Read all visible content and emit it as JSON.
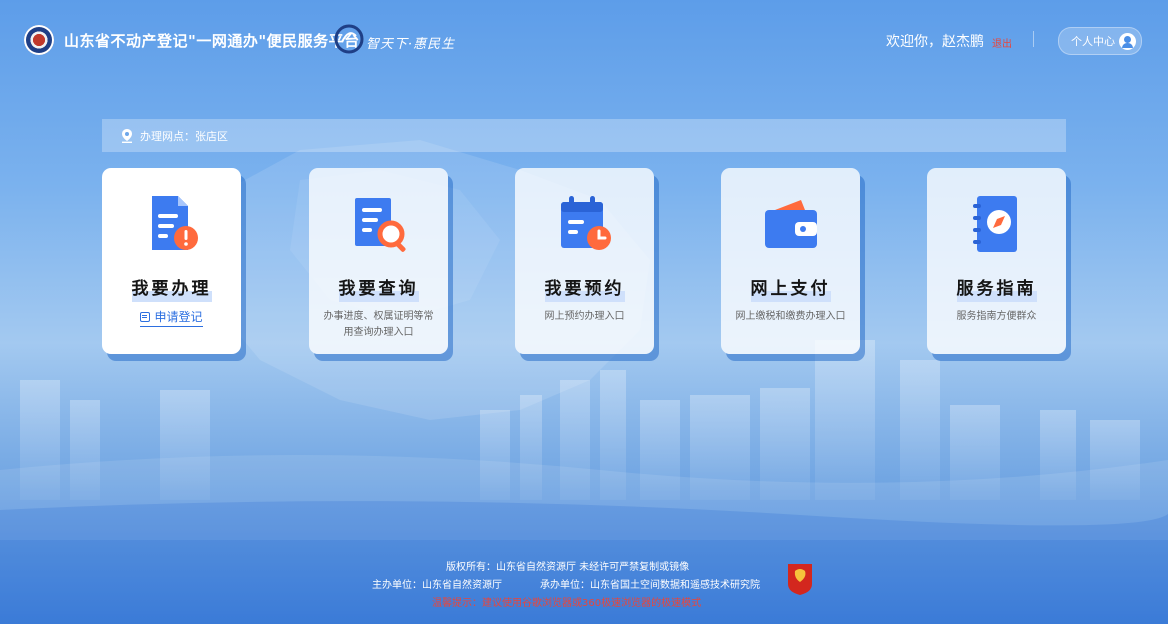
{
  "header": {
    "site_title": "山东省不动产登记\"一网通办\"便民服务平台",
    "slogan": "智天下·惠民生",
    "welcome": "欢迎你，赵杰鹏",
    "logout_label": "退出",
    "user_center_label": "个人中心"
  },
  "location": {
    "label": "办理网点：张店区"
  },
  "cards": [
    {
      "title": "我要办理",
      "link_label": "申请登记",
      "icon": "document-alert-icon"
    },
    {
      "title": "我要查询",
      "desc": "办事进度、权属证明等常用查询办理入口",
      "icon": "document-search-icon"
    },
    {
      "title": "我要预约",
      "desc": "网上预约办理入口",
      "icon": "calendar-clock-icon"
    },
    {
      "title": "网上支付",
      "desc": "网上缴税和缴费办理入口",
      "icon": "wallet-icon"
    },
    {
      "title": "服务指南",
      "desc": "服务指南方便群众",
      "icon": "compass-book-icon"
    }
  ],
  "footer": {
    "copyright": "版权所有：山东省自然资源厅 未经许可严禁复制或镜像",
    "host": "主办单位：山东省自然资源厅",
    "organizer": "承办单位：山东省国土空间数据和遥感技术研究院",
    "tip": "温馨提示：建议使用谷歌浏览器或360极速浏览器的极速模式"
  },
  "colors": {
    "accent_blue": "#2d6fe0",
    "warning_red": "#e8463c",
    "card_bg": "#ffffff"
  }
}
